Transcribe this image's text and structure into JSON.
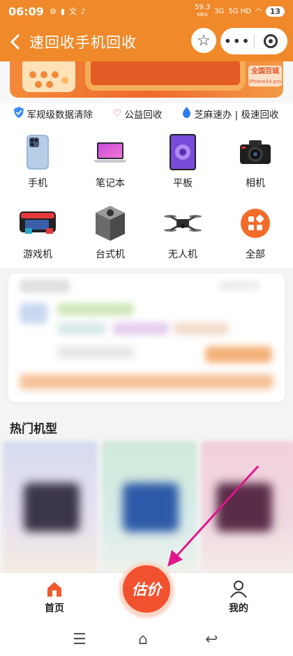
{
  "status_bar": {
    "time": "06:09",
    "speed": "59.3",
    "speed_unit": "KB/s",
    "net1": "3G",
    "net2": "5G HD",
    "battery": "13"
  },
  "header": {
    "title": "速回收手机回收",
    "star_icon": "star-icon",
    "more_icon": "ellipsis-icon",
    "close_icon": "target-icon"
  },
  "banner": {
    "tag_line1": "全国百城",
    "tag_line2": "iPhone14 pro"
  },
  "features": [
    {
      "label": "军规级数据清除",
      "icon": "shield-icon"
    },
    {
      "label": "公益回收",
      "icon": "heart-icon"
    },
    {
      "label": "芝麻速办 | 极速回收",
      "icon": "sesame-drop-icon"
    }
  ],
  "categories": [
    {
      "label": "手机",
      "icon": "phone-icon"
    },
    {
      "label": "笔记本",
      "icon": "laptop-icon"
    },
    {
      "label": "平板",
      "icon": "tablet-icon"
    },
    {
      "label": "相机",
      "icon": "camera-icon"
    },
    {
      "label": "游戏机",
      "icon": "game-console-icon"
    },
    {
      "label": "台式机",
      "icon": "desktop-icon"
    },
    {
      "label": "无人机",
      "icon": "drone-icon"
    },
    {
      "label": "全部",
      "icon": "grid-icon"
    }
  ],
  "hot_section": {
    "title": "热门机型"
  },
  "tabbar": {
    "home": "首页",
    "estimate": "估价",
    "mine": "我的"
  },
  "colors": {
    "brand": "#f0892a",
    "accent": "#f25130",
    "arrow": "#e0168c"
  }
}
